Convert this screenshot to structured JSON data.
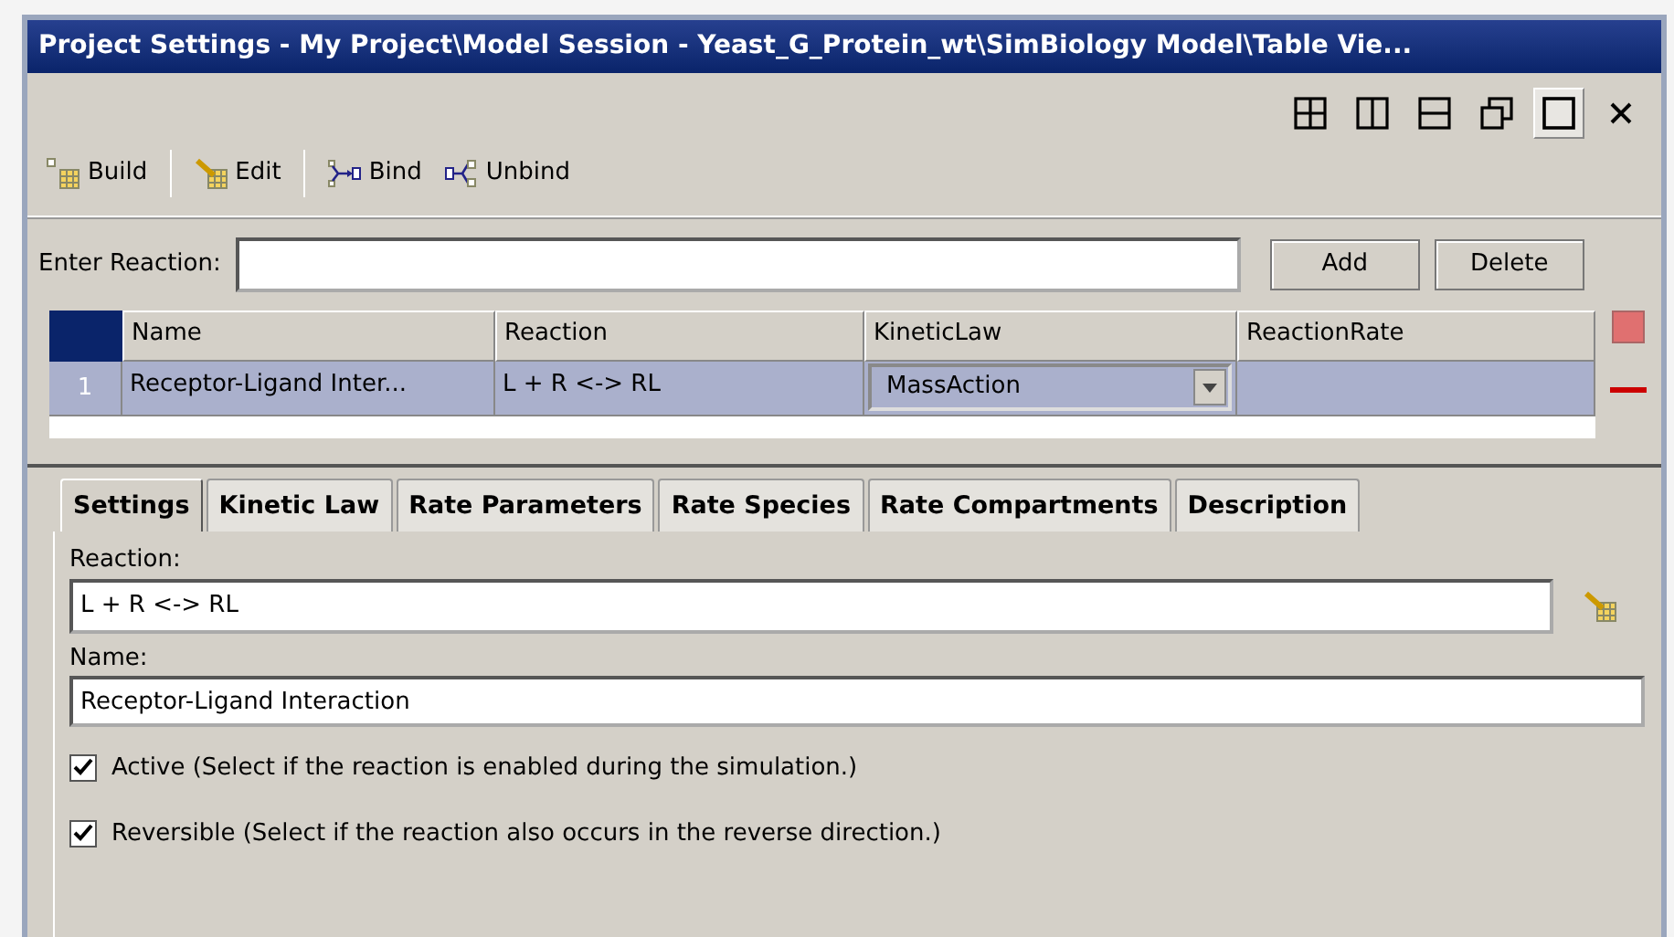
{
  "window": {
    "title": "Project Settings - My Project\\Model Session - Yeast_G_Protein_wt\\SimBiology Model\\Table Vie..."
  },
  "layout_buttons": [
    {
      "kind": "grid4",
      "selected": false
    },
    {
      "kind": "cols",
      "selected": false
    },
    {
      "kind": "rows",
      "selected": false
    },
    {
      "kind": "restore",
      "selected": false
    },
    {
      "kind": "maximize",
      "selected": true
    },
    {
      "kind": "close",
      "selected": false
    }
  ],
  "toolbar": [
    {
      "kind": "build",
      "label": "Build"
    },
    {
      "kind": "edit",
      "label": "Edit"
    },
    {
      "kind": "bind",
      "label": "Bind"
    },
    {
      "kind": "unbind",
      "label": "Unbind"
    }
  ],
  "enter_reaction": {
    "label": "Enter Reaction:",
    "buttons": [
      "Add",
      "Delete"
    ]
  },
  "table": {
    "columns": [
      "Name",
      "Reaction",
      "KineticLaw",
      "ReactionRate"
    ],
    "rows": [
      {
        "index": "1",
        "name": "Receptor-Ligand Inter...",
        "reaction": "L + R <-> RL",
        "kinetic_law": "MassAction",
        "selected": true
      }
    ]
  },
  "tabs": [
    {
      "label": "Settings",
      "selected": true
    },
    {
      "label": "Kinetic Law",
      "selected": false
    },
    {
      "label": "Rate Parameters",
      "selected": false
    },
    {
      "label": "Rate Species",
      "selected": false
    },
    {
      "label": "Rate Compartments",
      "selected": false
    },
    {
      "label": "Description",
      "selected": false
    }
  ],
  "settings": {
    "reaction_label": "Reaction:",
    "reaction_value": "L + R <-> RL",
    "name_label": "Name:",
    "name_value": "Receptor-Ligand Interaction",
    "checkboxes": [
      {
        "label": "Active (Select if the reaction is enabled during the simulation.)",
        "checked": true
      },
      {
        "label": "Reversible (Select if the reaction also occurs in the reverse direction.)",
        "checked": true
      }
    ]
  }
}
